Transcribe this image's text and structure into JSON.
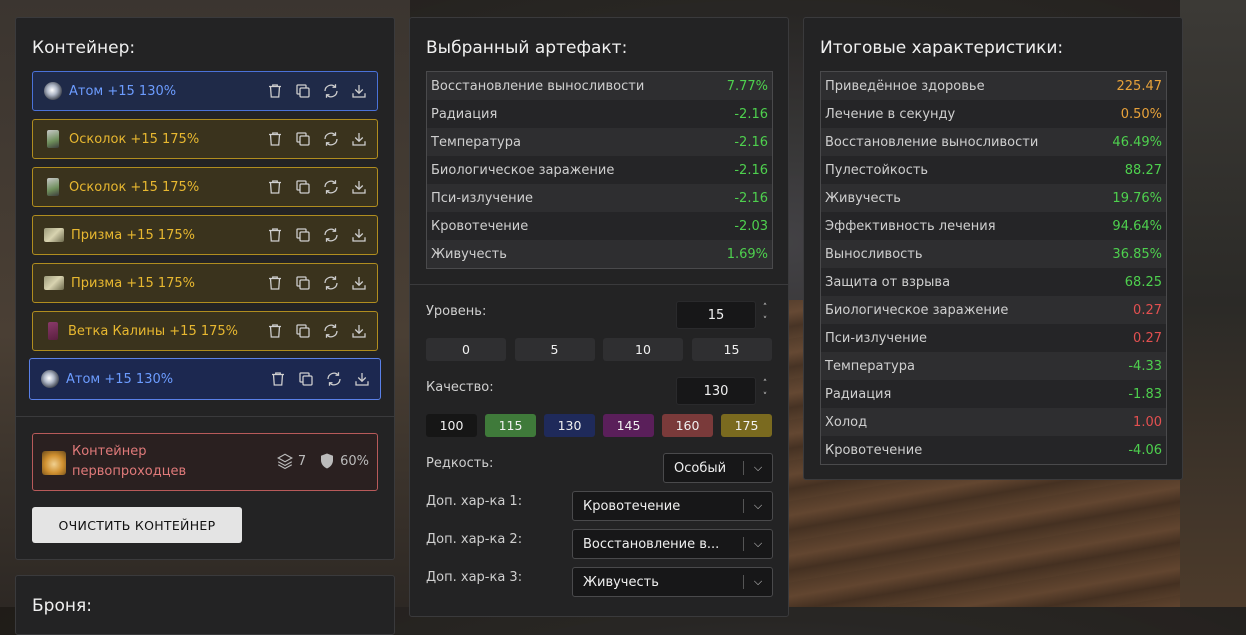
{
  "container": {
    "title": "Контейнер:",
    "items": [
      {
        "label": "Атом +15 130%",
        "icon": "atom-icon",
        "tone": "blue"
      },
      {
        "label": "Осколок +15 175%",
        "icon": "shard-icon",
        "tone": "gold"
      },
      {
        "label": "Осколок +15 175%",
        "icon": "shard-icon",
        "tone": "gold"
      },
      {
        "label": "Призма +15 175%",
        "icon": "prism-icon",
        "tone": "gold"
      },
      {
        "label": "Призма +15 175%",
        "icon": "prism-icon",
        "tone": "gold"
      },
      {
        "label": "Ветка Калины +15 175%",
        "icon": "branch-icon",
        "tone": "gold"
      },
      {
        "label": "Атом +15 130%",
        "icon": "atom-icon",
        "tone": "blue",
        "selected": true
      }
    ],
    "actions": [
      "trash-icon",
      "copy-icon",
      "refresh-icon",
      "download-icon"
    ],
    "card": {
      "name": "Контейнер первопроходцев",
      "slots": "7",
      "protection": "60%"
    },
    "clear_label": "ОЧИСТИТЬ КОНТЕЙНЕР"
  },
  "armor": {
    "title": "Броня:"
  },
  "artifact": {
    "title": "Выбранный артефакт:",
    "stats": [
      {
        "name": "Восстановление выносливости",
        "value": "7.77%",
        "color": "green"
      },
      {
        "name": "Радиация",
        "value": "-2.16",
        "color": "green"
      },
      {
        "name": "Температура",
        "value": "-2.16",
        "color": "green"
      },
      {
        "name": "Биологическое заражение",
        "value": "-2.16",
        "color": "green"
      },
      {
        "name": "Пси-излучение",
        "value": "-2.16",
        "color": "green"
      },
      {
        "name": "Кровотечение",
        "value": "-2.03",
        "color": "green"
      },
      {
        "name": "Живучесть",
        "value": "1.69%",
        "color": "green"
      }
    ],
    "level_label": "Уровень:",
    "level_value": "15",
    "level_presets": [
      "0",
      "5",
      "10",
      "15"
    ],
    "quality_label": "Качество:",
    "quality_value": "130",
    "quality_presets": [
      {
        "label": "100",
        "color": "#161616"
      },
      {
        "label": "115",
        "color": "#3f7a3a"
      },
      {
        "label": "130",
        "color": "#1f2a5a"
      },
      {
        "label": "145",
        "color": "#5a1f5a"
      },
      {
        "label": "160",
        "color": "#7a3a3a"
      },
      {
        "label": "175",
        "color": "#7a6a1f"
      }
    ],
    "rarity_label": "Редкость:",
    "rarity_value": "Особый",
    "extra1_label": "Доп. хар-ка 1:",
    "extra1_value": "Кровотечение",
    "extra2_label": "Доп. хар-ка 2:",
    "extra2_value": "Восстановление в...",
    "extra3_label": "Доп. хар-ка 3:",
    "extra3_value": "Живучесть"
  },
  "summary": {
    "title": "Итоговые характеристики:",
    "stats": [
      {
        "name": "Приведённое здоровье",
        "value": "225.47",
        "color": "orange"
      },
      {
        "name": "Лечение в секунду",
        "value": "0.50%",
        "color": "orange"
      },
      {
        "name": "Восстановление выносливости",
        "value": "46.49%",
        "color": "green"
      },
      {
        "name": "Пулестойкость",
        "value": "88.27",
        "color": "green"
      },
      {
        "name": "Живучесть",
        "value": "19.76%",
        "color": "green"
      },
      {
        "name": "Эффективность лечения",
        "value": "94.64%",
        "color": "green"
      },
      {
        "name": "Выносливость",
        "value": "36.85%",
        "color": "green"
      },
      {
        "name": "Защита от взрыва",
        "value": "68.25",
        "color": "green"
      },
      {
        "name": "Биологическое заражение",
        "value": "0.27",
        "color": "red"
      },
      {
        "name": "Пси-излучение",
        "value": "0.27",
        "color": "red"
      },
      {
        "name": "Температура",
        "value": "-4.33",
        "color": "green"
      },
      {
        "name": "Радиация",
        "value": "-1.83",
        "color": "green"
      },
      {
        "name": "Холод",
        "value": "1.00",
        "color": "red"
      },
      {
        "name": "Кровотечение",
        "value": "-4.06",
        "color": "green"
      }
    ]
  }
}
